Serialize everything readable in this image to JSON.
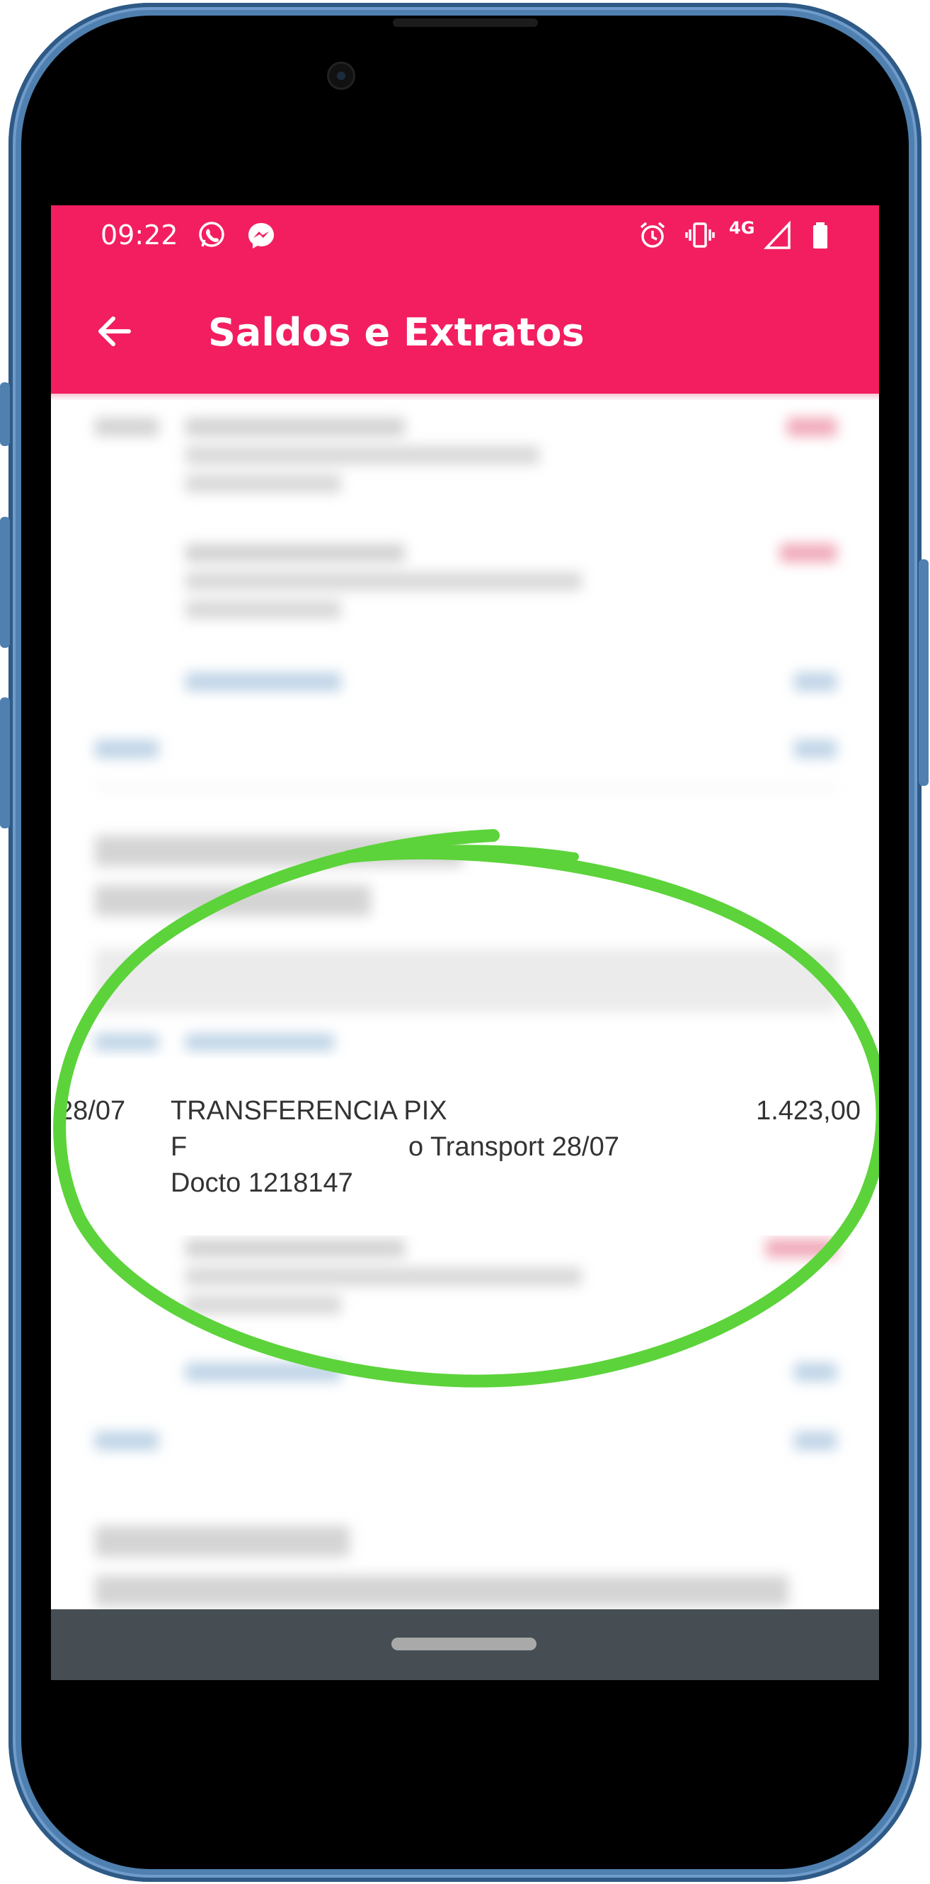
{
  "status_bar": {
    "time": "09:22",
    "network": "4G",
    "icons": [
      "whatsapp-icon",
      "messenger-icon",
      "alarm-icon",
      "vibrate-icon",
      "signal-icon",
      "battery-icon"
    ]
  },
  "app_bar": {
    "title": "Saldos e Extratos",
    "back_icon": "arrow-left-icon"
  },
  "transaction": {
    "date": "28/07",
    "description": "TRANSFERENCIA PIX",
    "detail": "o Transport 28/07",
    "detail_prefix": "F",
    "doc": "Docto 1218147",
    "value": "1.423,00"
  },
  "annotation": {
    "color": "#5cd33a",
    "shape": "hand-drawn-ellipse"
  },
  "colors": {
    "brand": "#f21e60",
    "nav": "#464e53"
  }
}
